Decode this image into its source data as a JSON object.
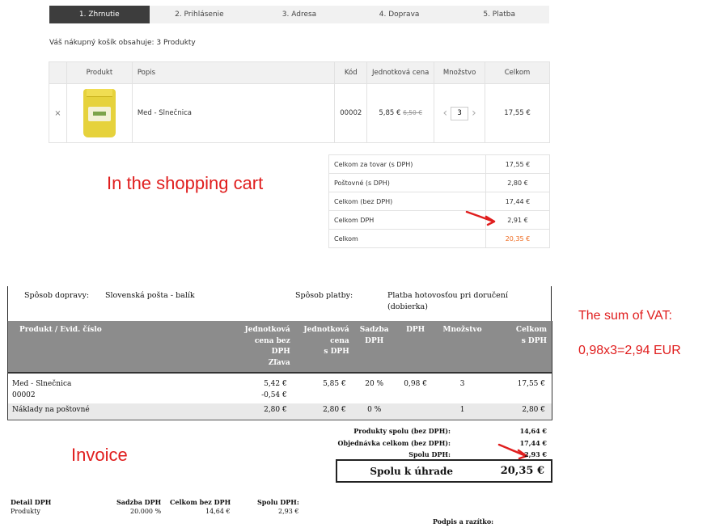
{
  "steps": [
    {
      "label": "1. Zhrnutie",
      "active": true
    },
    {
      "label": "2. Prihlásenie"
    },
    {
      "label": "3. Adresa"
    },
    {
      "label": "4. Doprava"
    },
    {
      "label": "5. Platba"
    }
  ],
  "cart": {
    "summary": "Váš nákupný košík obsahuje: 3 Produkty",
    "headers": {
      "product": "Produkt",
      "description": "Popis",
      "code": "Kód",
      "unit_price": "Jednotková cena",
      "quantity": "Množstvo",
      "total": "Celkom"
    },
    "item": {
      "remove_icon": "×",
      "name": "Med - Slnečnica",
      "code": "00002",
      "price": "5,85 €",
      "old_price": "6,50 €",
      "quantity": "3",
      "total": "17,55 €"
    },
    "totals": [
      {
        "label": "Celkom za tovar (s DPH)",
        "value": "17,55 €"
      },
      {
        "label": "Poštovné (s DPH)",
        "value": "2,80 €"
      },
      {
        "label": "Celkom (bez DPH)",
        "value": "17,44 €"
      },
      {
        "label": "Celkom DPH",
        "value": "2,91 €"
      },
      {
        "label": "Celkom",
        "value": "20,35 €"
      }
    ]
  },
  "annotations": {
    "cart": "In the shopping cart",
    "invoice": "Invoice",
    "vat_title": "The sum of VAT:",
    "vat_calc": "0,98x3=2,94 EUR"
  },
  "invoice": {
    "shipping_label": "Spôsob dopravy:",
    "shipping_value": "Slovenská pošta - balík",
    "payment_label": "Spôsob platby:",
    "payment_value_1": "Platba hotovosťou pri doručení",
    "payment_value_2": "(dobierka)",
    "headers": {
      "product_1": "Produkt / Evid. číslo",
      "unit_net_1": "Jednotková",
      "unit_net_2": "cena bez",
      "unit_net_3": "DPH",
      "unit_net_4": "Zľava",
      "unit_gross_1": "Jednotková",
      "unit_gross_2": "cena",
      "unit_gross_3": "s DPH",
      "rate_1": "Sadzba",
      "rate_2": "DPH",
      "vat": "DPH",
      "quantity": "Množstvo",
      "total_1": "Celkom",
      "total_2": "s DPH"
    },
    "row1": {
      "name": "Med - Slnečnica",
      "code": "00002",
      "unit_net": "5,42 €",
      "discount": "-0,54 €",
      "unit_gross": "5,85 €",
      "rate": "20 %",
      "vat": "0,98 €",
      "quantity": "3",
      "total": "17,55 €"
    },
    "row2": {
      "name": "Náklady na poštovné",
      "unit_net": "2,80 €",
      "unit_gross": "2,80 €",
      "rate": "0 %",
      "quantity": "1",
      "total": "2,80 €"
    },
    "sums": [
      {
        "label": "Produkty spolu (bez DPH):",
        "value": "14,64 €"
      },
      {
        "label": "Objednávka celkom (bez DPH):",
        "value": "17,44 €"
      },
      {
        "label": "Spolu DPH:",
        "value": "2,93 €"
      }
    ],
    "grand_label": "Spolu k úhrade",
    "grand_value": "20,35 €",
    "vat_detail": {
      "h1": "Detail DPH",
      "h2": "Sadzba DPH",
      "h3": "Celkom bez DPH",
      "h4": "Spolu DPH:",
      "v1": "Produkty",
      "v2": "20.000 %",
      "v3": "14,64 €",
      "v4": "2,93 €"
    },
    "signature": "Podpis a razítko:"
  },
  "colors": {
    "accent_orange": "#ee6a1f",
    "annotation_red": "#e01e1e",
    "active_step": "#3d3d3d"
  }
}
